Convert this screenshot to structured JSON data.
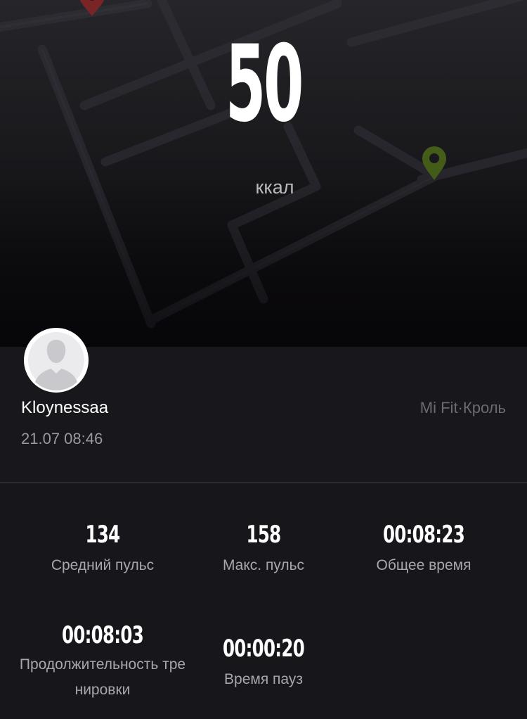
{
  "summary": {
    "calories_value": "50",
    "calories_unit": "ккал"
  },
  "user": {
    "name": "Kloynessaa",
    "datetime": "21.07 08:46",
    "activity_type": "Mi Fit·Кроль"
  },
  "stats": [
    {
      "value": "134",
      "label": "Средний пульс"
    },
    {
      "value": "158",
      "label": "Макс. пульс"
    },
    {
      "value": "00:08:23",
      "label": "Общее время"
    },
    {
      "value": "00:08:03",
      "label": "Продолжительность тренировки"
    },
    {
      "value": "00:00:20",
      "label": "Время пауз"
    }
  ],
  "colors": {
    "background": "#17161a",
    "text_primary": "#ffffff",
    "text_secondary": "#a8a7ac",
    "map_pin_start": "#c23a3a",
    "map_pin_end": "#5b7a1f"
  },
  "icons": {
    "avatar": "user-silhouette-icon",
    "map_pin_start": "map-pin-icon",
    "map_pin_end": "map-pin-icon"
  }
}
